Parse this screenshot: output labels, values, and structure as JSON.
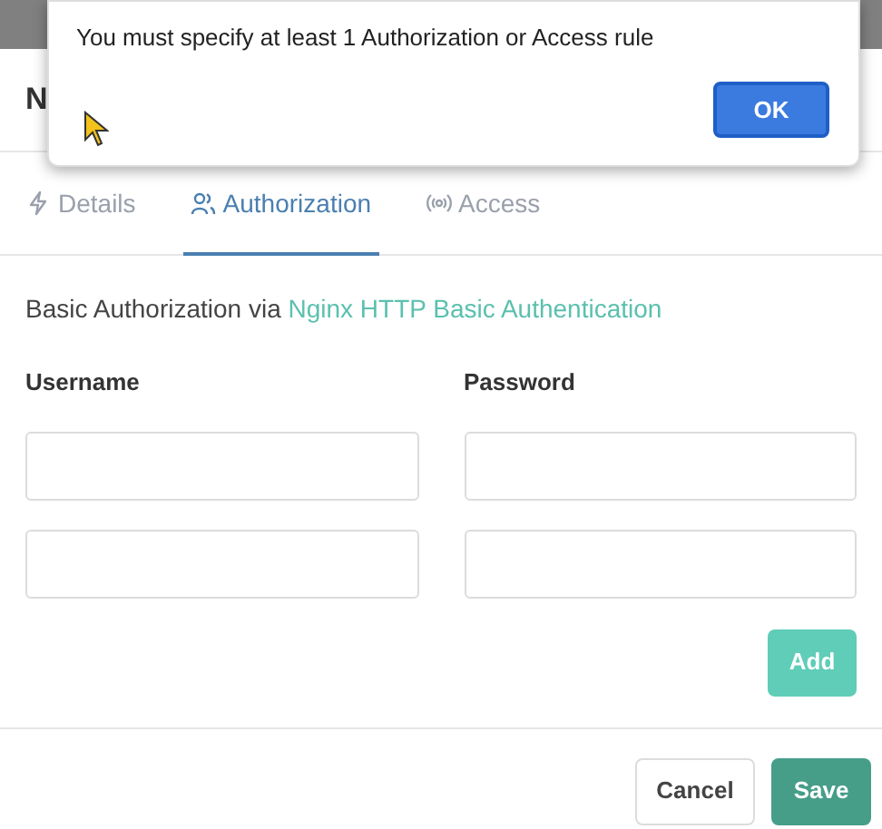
{
  "modal": {
    "title": "N"
  },
  "alert": {
    "message": "You must specify at least 1 Authorization or Access rule",
    "button": "OK"
  },
  "tabs": [
    {
      "kind": "details",
      "label": "Details",
      "selected": false
    },
    {
      "kind": "authorization",
      "label": "Authorization",
      "selected": true
    },
    {
      "kind": "access",
      "label": "Access",
      "selected": false
    }
  ],
  "intro": {
    "text": "Basic Authorization via",
    "link": "Nginx HTTP Basic Authentication"
  },
  "columns": [
    "Username",
    "Password"
  ],
  "credential_rows": [
    {
      "kind": "empty"
    },
    {
      "kind": "empty"
    }
  ],
  "add_button": {
    "label": "Add",
    "disabled": true
  },
  "footer_buttons": [
    {
      "label": "Cancel",
      "kind": "secondary"
    },
    {
      "label": "Save",
      "kind": "primary"
    }
  ]
}
